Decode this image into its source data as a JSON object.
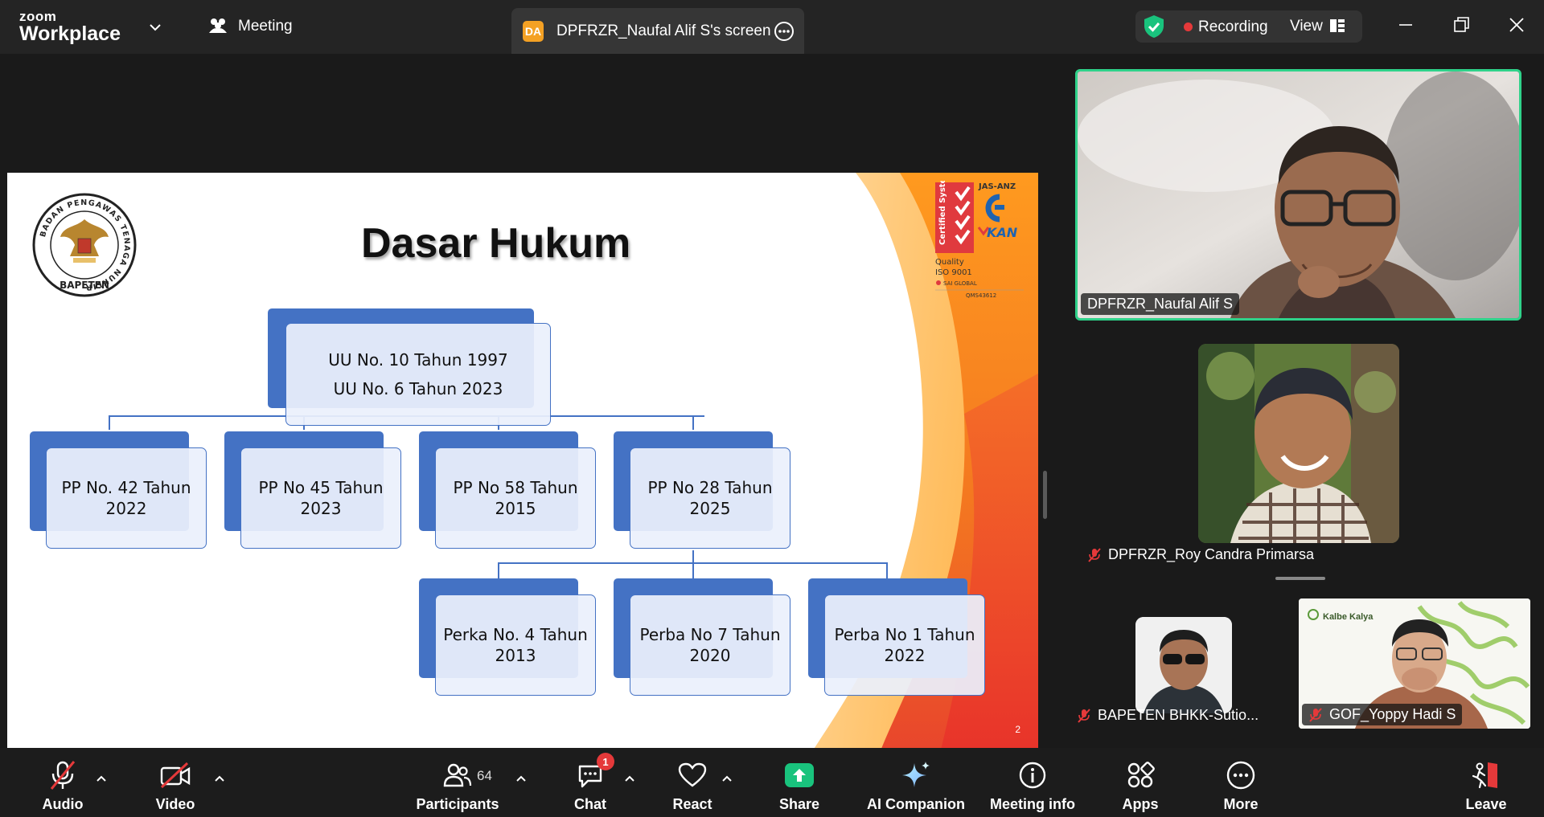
{
  "titlebar": {
    "brand_line1": "zoom",
    "brand_line2": "Workplace",
    "meeting_label": "Meeting",
    "screen_tab_badge": "DA",
    "screen_tab_label": "DPFRZR_Naufal Alif S's screen",
    "recording_label": "Recording",
    "view_label": "View"
  },
  "slide": {
    "title": "Dasar Hukum",
    "page_number": "2",
    "root": [
      "UU No. 10 Tahun 1997",
      "UU No. 6 Tahun 2023"
    ],
    "level2": [
      [
        "PP No. 42 Tahun",
        "2022"
      ],
      [
        "PP No 45 Tahun",
        "2023"
      ],
      [
        "PP No 58 Tahun",
        "2015"
      ],
      [
        "PP No 28 Tahun",
        "2025"
      ]
    ],
    "level3": [
      [
        "Perka No. 4 Tahun",
        "2013"
      ],
      [
        "Perba No 7 Tahun",
        "2020"
      ],
      [
        "Perba No 1 Tahun",
        "2022"
      ]
    ],
    "seal_ring_text": "BADAN PENGAWAS TENAGA NUKLIR",
    "seal_name": "BAPETEN",
    "cert_top": "JAS-ANZ",
    "cert_vertical": "Certified System",
    "cert_kan": "KAN",
    "cert_quality": "Quality",
    "cert_iso": "ISO 9001",
    "cert_sai": "SAI GLOBAL",
    "cert_code": "QMS43612"
  },
  "participants": [
    {
      "name": "DPFRZR_Naufal Alif S",
      "muted": false,
      "active_speaker": true
    },
    {
      "name": "DPFRZR_Roy Candra Primarsa",
      "muted": true
    },
    {
      "name": "BAPETEN BHKK-Sutio...",
      "muted": true
    },
    {
      "name": "GOF_Yoppy Hadi S",
      "muted": true,
      "background_text": "Kalbe Kalya"
    }
  ],
  "toolbar": {
    "audio": "Audio",
    "video": "Video",
    "participants": "Participants",
    "participants_count": "64",
    "chat": "Chat",
    "chat_badge": "1",
    "react": "React",
    "share": "Share",
    "ai_companion": "AI Companion",
    "meeting_info": "Meeting info",
    "apps": "Apps",
    "more": "More",
    "leave": "Leave"
  },
  "colors": {
    "accent_green": "#19c37d",
    "active_border": "#2fd28a",
    "record_red": "#e5393a",
    "diagram_blue": "#4472c4",
    "slide_orange": "#f47920"
  }
}
